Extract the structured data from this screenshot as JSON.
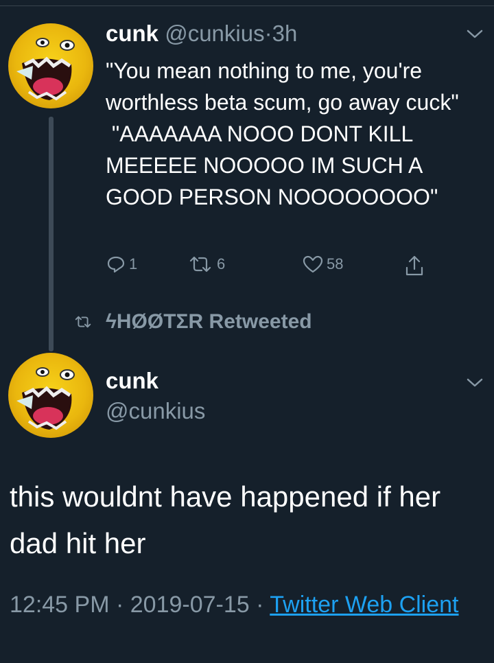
{
  "tweet1": {
    "name": "cunk",
    "handle": "@cunkius",
    "separator": "·",
    "time": "3h",
    "text": "\"You mean nothing to me, you're worthless beta scum, go away cuck\"\n \"AAAAAAA NOOO DONT KILL MEEEEE NOOOOO IM SUCH A GOOD PERSON NOOOOOOOO\"",
    "actions": {
      "reply_icon": "reply-icon",
      "reply_count": "1",
      "retweet_icon": "retweet-icon",
      "retweet_count": "6",
      "like_icon": "heart-icon",
      "like_count": "58",
      "share_icon": "share-icon"
    }
  },
  "social_context": {
    "icon": "retweet-icon",
    "text": "ϟHØØTΣR Retweeted"
  },
  "tweet2": {
    "name": "cunk",
    "handle": "@cunkius",
    "text": "this wouldnt have happened if her dad hit her",
    "timestamp": "12:45 PM · 2019-07-15 · ",
    "source": "Twitter Web Client"
  },
  "colors": {
    "background": "#15202b",
    "secondary_text": "#8899a6",
    "link": "#1da1f2",
    "thread_line": "#3d4a57"
  }
}
